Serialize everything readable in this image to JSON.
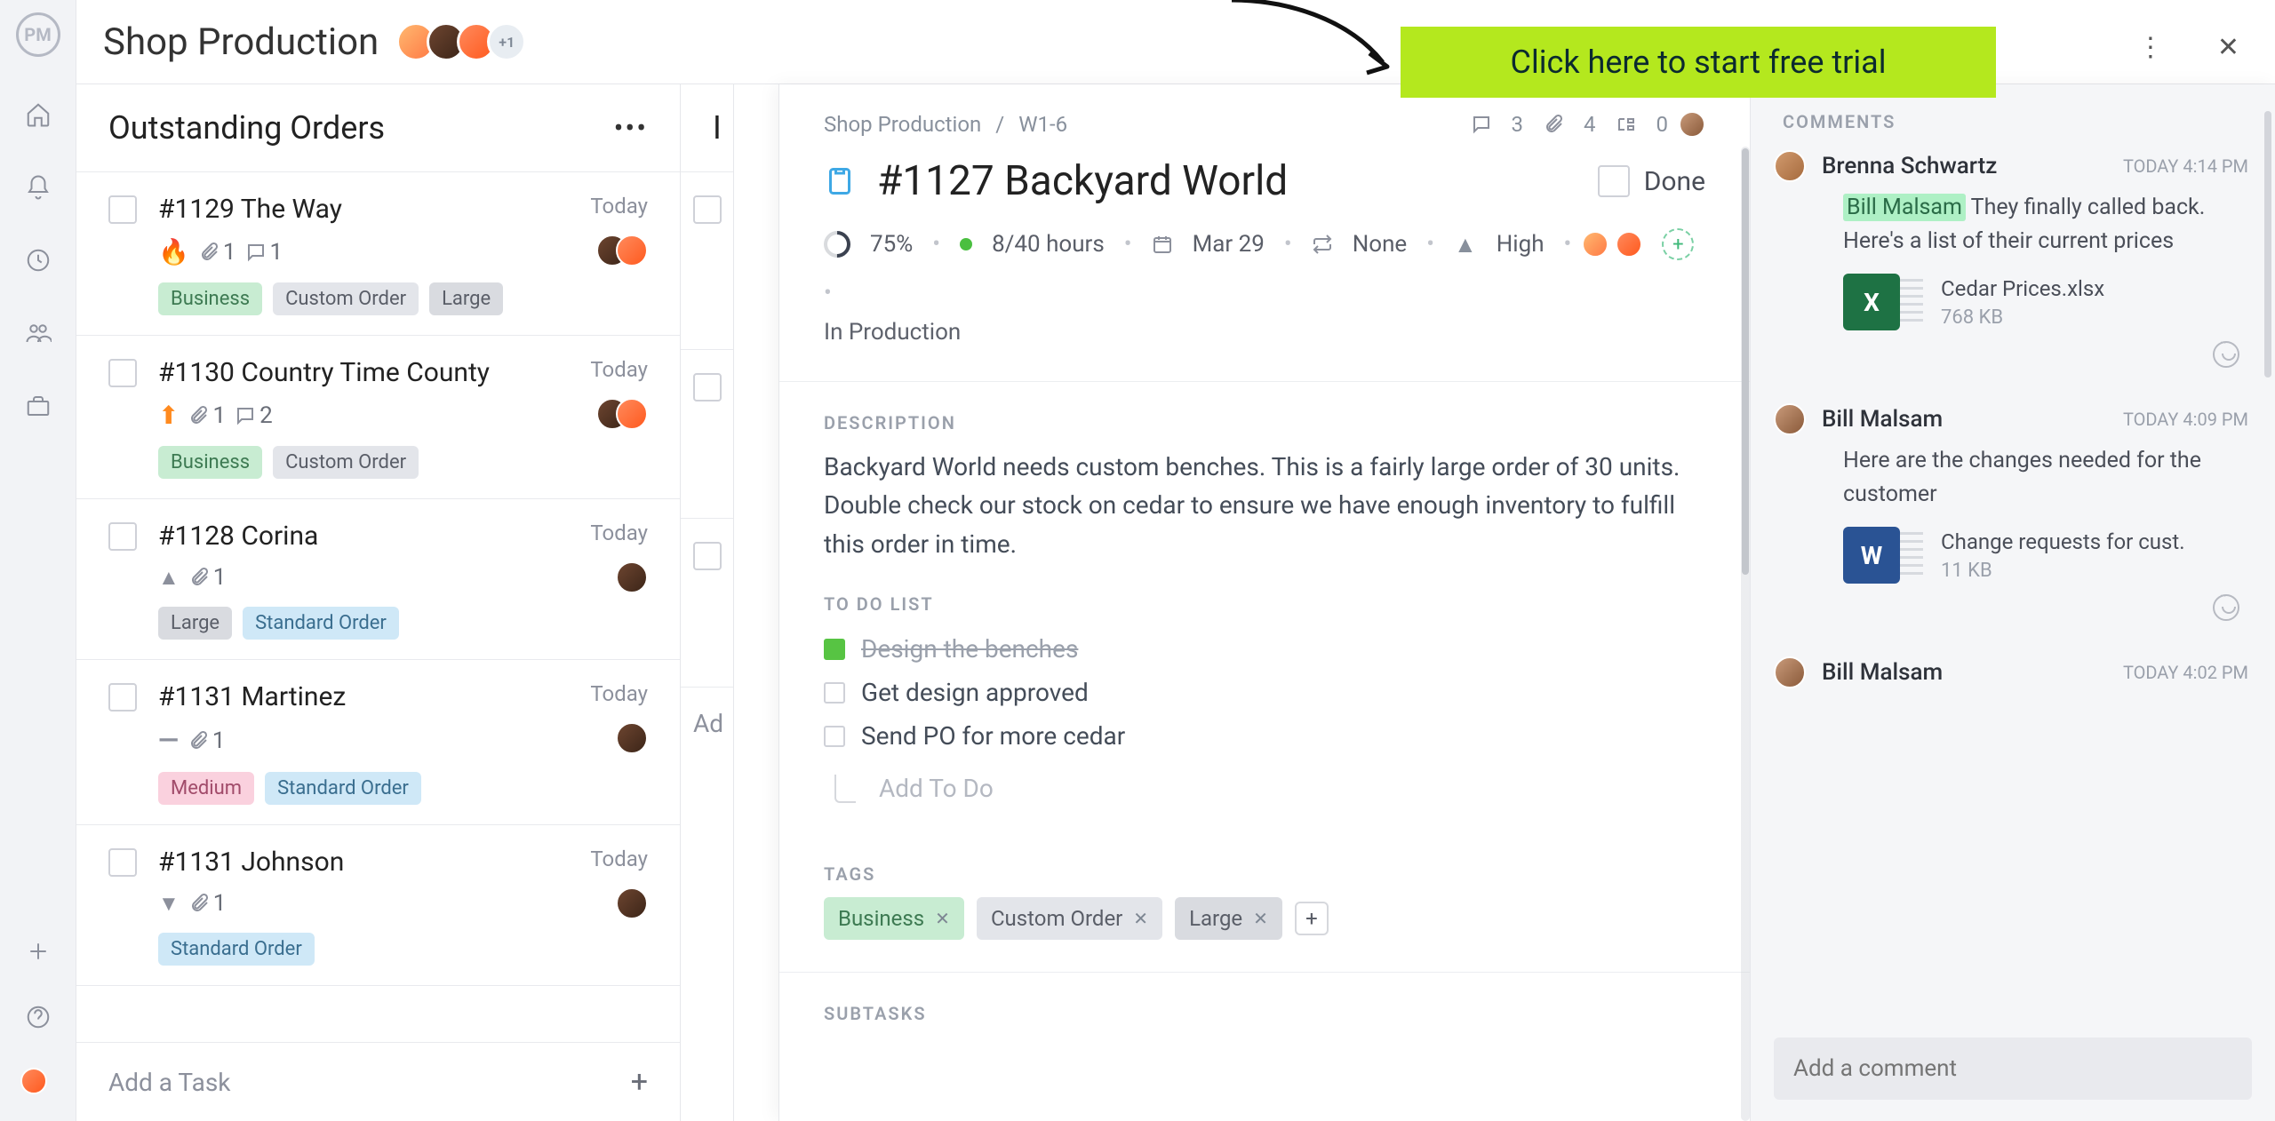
{
  "app": {
    "logo_text": "PM",
    "project_title": "Shop Production",
    "header_avatar_plus": "+1"
  },
  "cta": {
    "label": "Click here to start free trial"
  },
  "top_icons": {
    "more": "⋮",
    "close": "✕"
  },
  "column": {
    "title": "Outstanding Orders",
    "add_task_placeholder": "Add a Task",
    "peek_title": "I",
    "peek_add": "Ad"
  },
  "cards": [
    {
      "title": "#1129 The Way",
      "date": "Today",
      "priority": "flame",
      "attachments": "1",
      "comments": "1",
      "tags": [
        {
          "text": "Business",
          "cls": "business"
        },
        {
          "text": "Custom Order",
          "cls": "custom"
        },
        {
          "text": "Large",
          "cls": "large-t"
        }
      ],
      "assignees": 2
    },
    {
      "title": "#1130 Country Time County",
      "date": "Today",
      "priority": "arrow-up",
      "attachments": "1",
      "comments": "2",
      "tags": [
        {
          "text": "Business",
          "cls": "business"
        },
        {
          "text": "Custom Order",
          "cls": "custom"
        }
      ],
      "assignees": 2
    },
    {
      "title": "#1128 Corina",
      "date": "Today",
      "priority": "caret-up",
      "attachments": "1",
      "comments": "",
      "tags": [
        {
          "text": "Large",
          "cls": "large-t"
        },
        {
          "text": "Standard Order",
          "cls": "standard"
        }
      ],
      "assignees": 1
    },
    {
      "title": "#1131 Martinez",
      "date": "Today",
      "priority": "dash",
      "attachments": "1",
      "comments": "",
      "tags": [
        {
          "text": "Medium",
          "cls": "medium-t"
        },
        {
          "text": "Standard Order",
          "cls": "standard"
        }
      ],
      "assignees": 1
    },
    {
      "title": "#1131 Johnson",
      "date": "Today",
      "priority": "caret-down",
      "attachments": "1",
      "comments": "",
      "tags": [
        {
          "text": "Standard Order",
          "cls": "standard"
        }
      ],
      "assignees": 1
    }
  ],
  "detail": {
    "breadcrumb_project": "Shop Production",
    "breadcrumb_sep": "/",
    "breadcrumb_id": "W1-6",
    "counts": {
      "comments": "3",
      "attachments": "4",
      "subtasks": "0"
    },
    "title": "#1127 Backyard World",
    "done_label": "Done",
    "progress": "75%",
    "hours": "8/40 hours",
    "due": "Mar 29",
    "recurrence": "None",
    "priority": "High",
    "status_line": "In Production",
    "description_label": "DESCRIPTION",
    "description_text": "Backyard World needs custom benches. This is a fairly large order of 30 units. Double check our stock on cedar to ensure we have enough inventory to fulfill this order in time.",
    "todo_label": "TO DO LIST",
    "todos": [
      {
        "text": "Design the benches",
        "done": true
      },
      {
        "text": "Get design approved",
        "done": false
      },
      {
        "text": "Send PO for more cedar",
        "done": false
      }
    ],
    "add_todo_placeholder": "Add To Do",
    "tags_label": "TAGS",
    "tags": [
      {
        "text": "Business",
        "cls": "business"
      },
      {
        "text": "Custom Order",
        "cls": "custom"
      },
      {
        "text": "Large",
        "cls": "large-c"
      }
    ],
    "add_tag": "+",
    "subtasks_label": "SUBTASKS"
  },
  "comments": {
    "header": "COMMENTS",
    "input_placeholder": "Add a comment",
    "items": [
      {
        "author": "Brenna Schwartz",
        "time": "TODAY 4:14 PM",
        "mention": "Bill Malsam",
        "body_after_mention": " They finally called back. Here's a list of their current prices",
        "file_name": "Cedar Prices.xlsx",
        "file_size": "768 KB",
        "file_type": "X"
      },
      {
        "author": "Bill Malsam",
        "time": "TODAY 4:09 PM",
        "body": "Here are the changes needed for the customer",
        "file_name": "Change requests for cust.",
        "file_size": "11 KB",
        "file_type": "W"
      },
      {
        "author": "Bill Malsam",
        "time": "TODAY 4:02 PM"
      }
    ]
  }
}
